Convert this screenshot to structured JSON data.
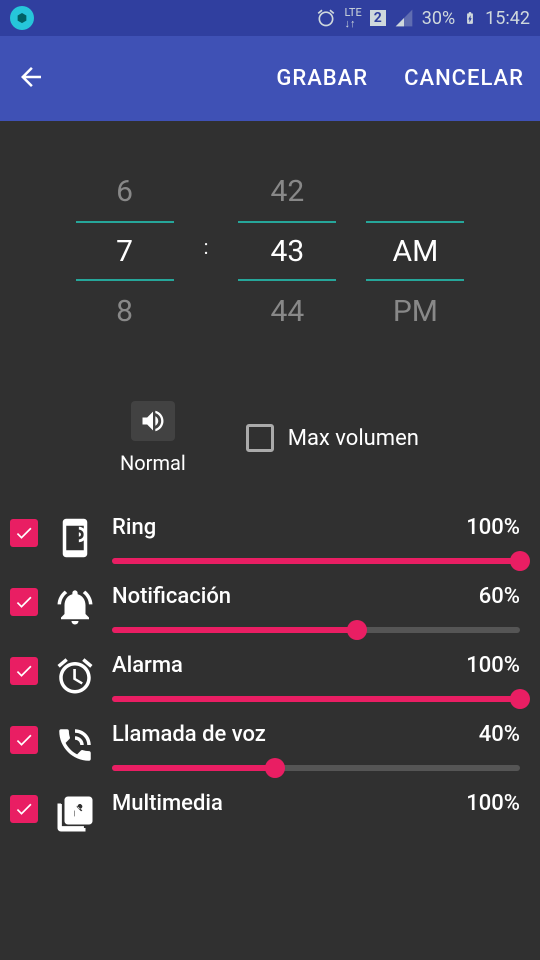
{
  "status_bar": {
    "battery": "30%",
    "time": "15:42",
    "lte": "LTE",
    "sim": "2"
  },
  "app_bar": {
    "save": "GRABAR",
    "cancel": "CANCELAR"
  },
  "time_picker": {
    "hour_prev": "6",
    "hour": "7",
    "hour_next": "8",
    "min_prev": "42",
    "min": "43",
    "min_next": "44",
    "ampm": "AM",
    "ampm_next": "PM"
  },
  "mode": {
    "label": "Normal"
  },
  "max_volume": {
    "label": "Max volumen"
  },
  "volumes": [
    {
      "name": "Ring",
      "pct": "100%",
      "value": 100
    },
    {
      "name": "Notificación",
      "pct": "60%",
      "value": 60
    },
    {
      "name": "Alarma",
      "pct": "100%",
      "value": 100
    },
    {
      "name": "Llamada de voz",
      "pct": "40%",
      "value": 40
    },
    {
      "name": "Multimedia",
      "pct": "100%",
      "value": 100
    }
  ]
}
